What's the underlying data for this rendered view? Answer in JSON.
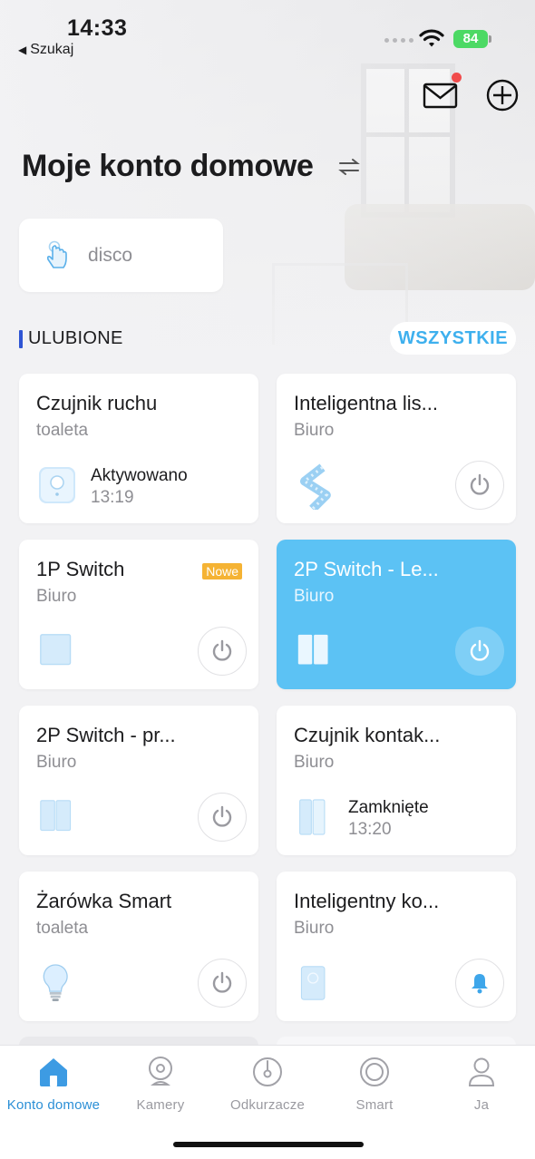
{
  "status_bar": {
    "time": "14:33",
    "back_label": "Szukaj",
    "battery": "84"
  },
  "header": {
    "title": "Moje konto domowe",
    "icons": [
      "mail-icon",
      "add-icon",
      "switch-home-icon"
    ]
  },
  "scene": {
    "name": "disco",
    "icon": "touch-hand-icon"
  },
  "favorites": {
    "label": "ULUBIONE",
    "all_button": "WSZYSTKIE"
  },
  "devices": [
    {
      "name": "Czujnik ruchu",
      "room": "toaleta",
      "icon": "motion-sensor-icon",
      "state": "Aktywowano",
      "time": "13:19"
    },
    {
      "name": "Inteligentna lis...",
      "room": "Biuro",
      "icon": "light-strip-icon",
      "control": "power"
    },
    {
      "name": "1P Switch",
      "room": "Biuro",
      "icon": "switch-1p-icon",
      "badge": "Nowe",
      "control": "power"
    },
    {
      "name": "2P Switch - Le...",
      "room": "Biuro",
      "icon": "switch-2p-icon",
      "control": "power",
      "active": true
    },
    {
      "name": "2P Switch - pr...",
      "room": "Biuro",
      "icon": "switch-2p-icon",
      "control": "power"
    },
    {
      "name": "Czujnik kontak...",
      "room": "Biuro",
      "icon": "contact-sensor-icon",
      "state": "Zamknięte",
      "time": "13:20"
    },
    {
      "name": "Żarówka Smart",
      "room": "toaleta",
      "icon": "bulb-icon",
      "control": "power"
    },
    {
      "name": "Inteligentny ko...",
      "room": "Biuro",
      "icon": "hub-icon",
      "control": "bell"
    }
  ],
  "tabs": [
    {
      "label": "Konto domowe",
      "icon": "home-icon",
      "active": true
    },
    {
      "label": "Kamery",
      "icon": "camera-icon"
    },
    {
      "label": "Odkurzacze",
      "icon": "vacuum-icon"
    },
    {
      "label": "Smart",
      "icon": "smart-icon"
    },
    {
      "label": "Ja",
      "icon": "person-icon"
    }
  ],
  "colors": {
    "accent": "#3eb0ee",
    "active_card": "#5cc2f4",
    "tab_active": "#2b8fd6",
    "badge": "#f5b334",
    "notification_dot": "#f14b4b",
    "favorites_bar": "#2f55d4"
  }
}
